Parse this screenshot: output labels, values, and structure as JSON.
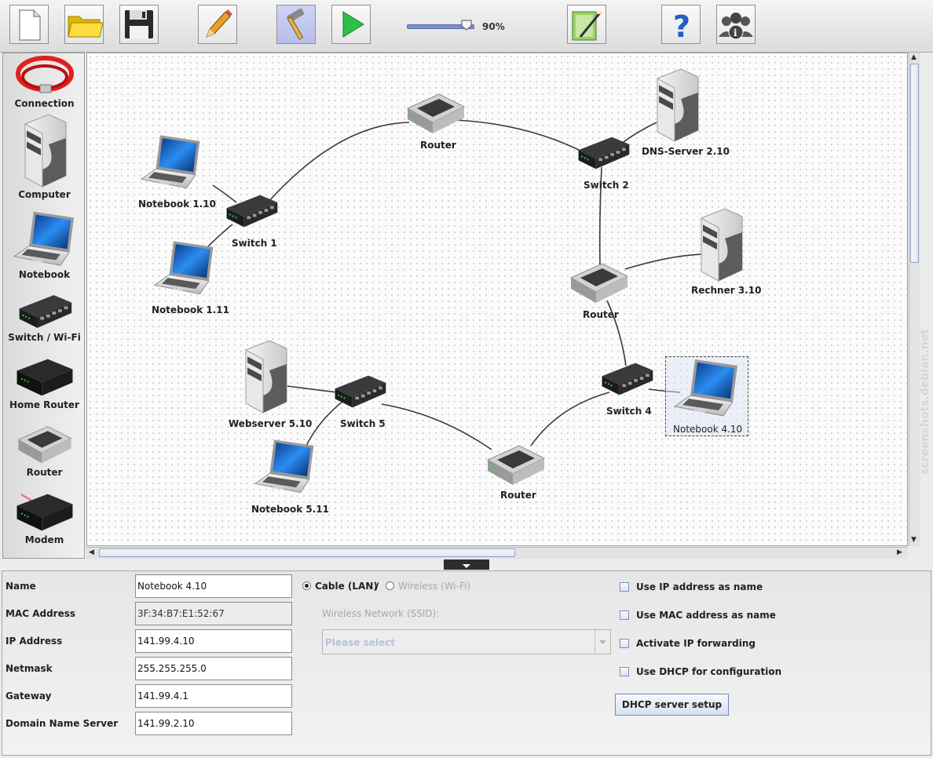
{
  "toolbar": {
    "zoom_label": "90%",
    "zoom_value_percent": 90
  },
  "palette": {
    "items": [
      {
        "label": "Connection",
        "icon": "cable-icon"
      },
      {
        "label": "Computer",
        "icon": "computer-icon"
      },
      {
        "label": "Notebook",
        "icon": "notebook-icon"
      },
      {
        "label": "Switch / Wi-Fi",
        "icon": "switch-icon"
      },
      {
        "label": "Home Router",
        "icon": "home-router-icon"
      },
      {
        "label": "Router",
        "icon": "router-icon"
      },
      {
        "label": "Modem",
        "icon": "modem-icon"
      }
    ]
  },
  "canvas": {
    "nodes": [
      {
        "label": "Notebook 1.10",
        "type": "notebook"
      },
      {
        "label": "Notebook 1.11",
        "type": "notebook"
      },
      {
        "label": "Switch 1",
        "type": "switch"
      },
      {
        "label": "Router",
        "type": "router"
      },
      {
        "label": "Switch 2",
        "type": "switch"
      },
      {
        "label": "DNS-Server 2.10",
        "type": "computer"
      },
      {
        "label": "Router",
        "type": "router"
      },
      {
        "label": "Rechner 3.10",
        "type": "computer"
      },
      {
        "label": "Switch 4",
        "type": "switch"
      },
      {
        "label": "Notebook 4.10",
        "type": "notebook"
      },
      {
        "label": "Router",
        "type": "router"
      },
      {
        "label": "Switch 5",
        "type": "switch"
      },
      {
        "label": "Webserver 5.10",
        "type": "computer"
      },
      {
        "label": "Notebook 5.11",
        "type": "notebook"
      }
    ]
  },
  "properties": {
    "name_label": "Name",
    "name_value": "Notebook 4.10",
    "mac_label": "MAC Address",
    "mac_value": "3F:34:B7:E1:52:67",
    "ip_label": "IP Address",
    "ip_value": "141.99.4.10",
    "netmask_label": "Netmask",
    "netmask_value": "255.255.255.0",
    "gateway_label": "Gateway",
    "gateway_value": "141.99.4.1",
    "dns_label": "Domain Name Server",
    "dns_value": "141.99.2.10",
    "cable_label": "Cable (LAN)",
    "separator": "/",
    "wireless_label": "Wireless (Wi-Fi)",
    "ssid_label": "Wireless Network (SSID):",
    "ssid_placeholder": "Please select",
    "check_ip_name": "Use IP address as name",
    "check_mac_name": "Use MAC address as name",
    "check_ip_forward": "Activate IP forwarding",
    "check_dhcp": "Use DHCP for configuration",
    "dhcp_button": "DHCP server setup"
  },
  "watermark": "screenshots.debian.net",
  "colors": {
    "accent": "#7d8fc7",
    "cable_red": "#e02020",
    "laptop_screen": "#1e6fd9"
  }
}
